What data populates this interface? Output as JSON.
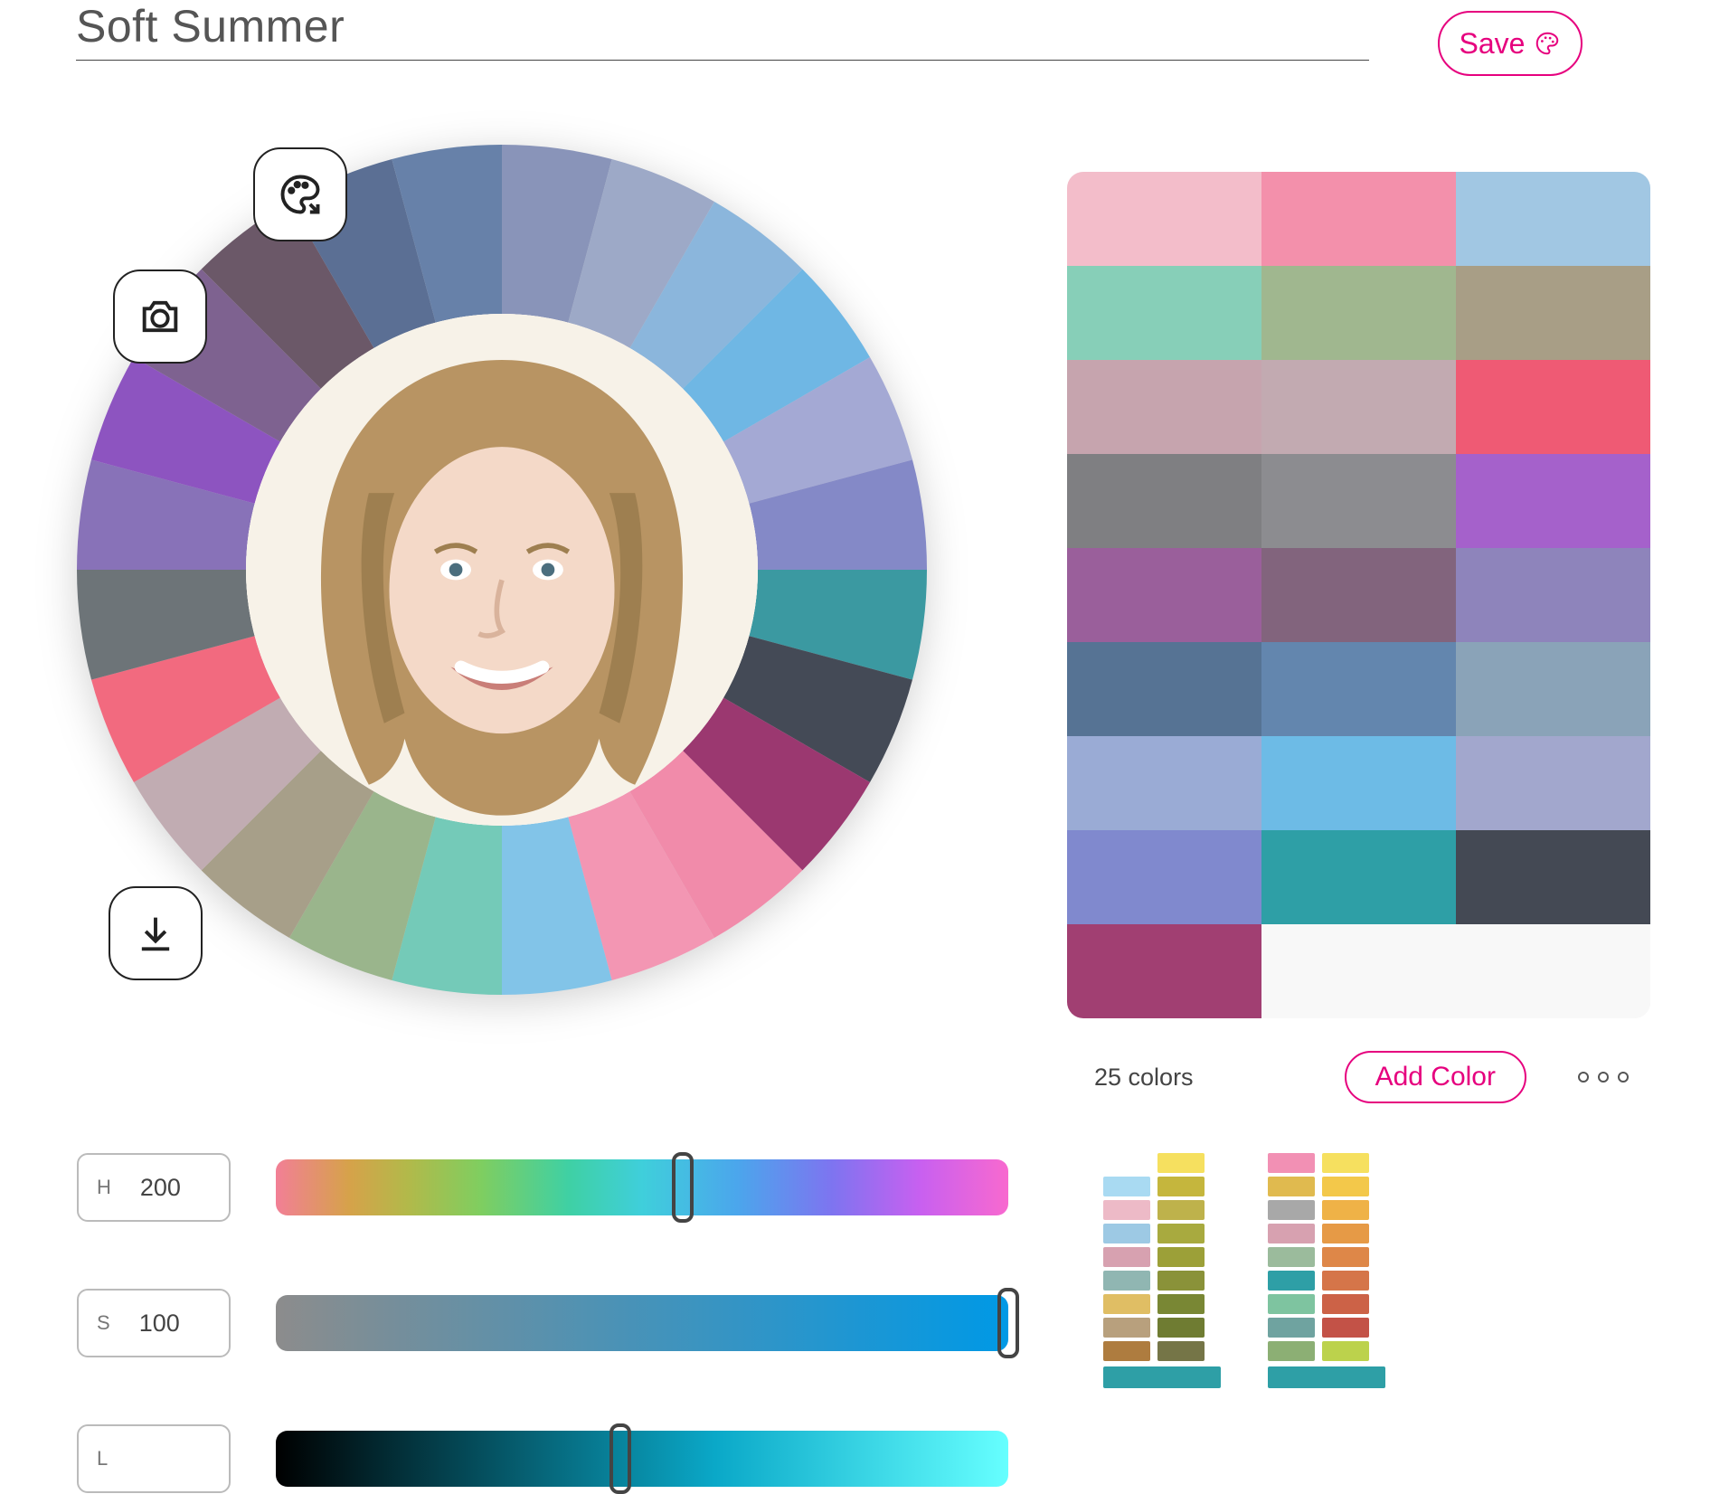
{
  "title": "Soft Summer",
  "save_label": "Save",
  "accent_color": "#E6007E",
  "wheel_colors": [
    "#8994B9",
    "#9DA9C7",
    "#8BB6DC",
    "#6FB7E4",
    "#A4A9D4",
    "#8489C7",
    "#3B99A1",
    "#444A56",
    "#9B3870",
    "#F18BAA",
    "#F396B3",
    "#82C4E8",
    "#74CAB8",
    "#9AB58C",
    "#A79F89",
    "#C1ACB2",
    "#F26A7F",
    "#6D7478",
    "#8872B8",
    "#8D54C0",
    "#7E6290",
    "#6B5868",
    "#5B6F94",
    "#6781A9"
  ],
  "swatches": [
    "#F3BDCA",
    "#F390AB",
    "#A1C7E3",
    "#87CFB8",
    "#A0B78F",
    "#A89E86",
    "#C6A4AE",
    "#C2AAB1",
    "#EF5A74",
    "#7F7F82",
    "#8C8C90",
    "#A561CB",
    "#9A5F9B",
    "#82647D",
    "#8E84BB",
    "#567394",
    "#6386AE",
    "#8AA3B8",
    "#9AABD5",
    "#6DBBE6",
    "#A2A7CD",
    "#8089CE",
    "#2E9FA6",
    "#444954",
    "#A13F72"
  ],
  "swatch_count_text": "25 colors",
  "add_color_label": "Add Color",
  "sliders": {
    "h": {
      "label": "H",
      "value": "200",
      "max": 360
    },
    "s": {
      "label": "S",
      "value": "100",
      "max": 100
    },
    "l": {
      "label": "L",
      "value": "",
      "max": 100,
      "pos": 47
    }
  },
  "ref_cols": [
    [
      [
        "#FFFFFF",
        "#A9DAF2",
        "#EDBAC7",
        "#9DC9E4",
        "#D7A1B0",
        "#90B6B2",
        "#E0BE64",
        "#B8A07D",
        "#AE7C3F"
      ],
      [
        "#F6E05F",
        "#C5B63D",
        "#BEB24B",
        "#A8AA3F",
        "#9CA038",
        "#8A9239",
        "#798734",
        "#6F7C32",
        "#757547"
      ]
    ],
    [
      [
        "#F290B4",
        "#E0BA4F",
        "#A8A8A8",
        "#D7A1B0",
        "#9BBB9C",
        "#2E9FA6",
        "#7EC4A0",
        "#6FA3A0",
        "#8CAF74"
      ],
      [
        "#F6E05F",
        "#F3C84A",
        "#EFB247",
        "#E69A46",
        "#DE8748",
        "#D57549",
        "#CC6247",
        "#C35247",
        "#BCD24C"
      ]
    ]
  ],
  "ref_wide_bar": "#2E9FA6"
}
